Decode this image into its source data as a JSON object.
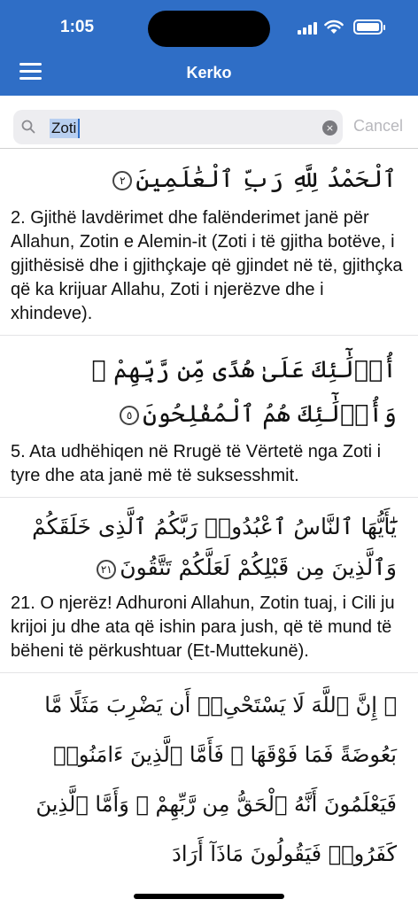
{
  "status_bar": {
    "time": "1:05"
  },
  "header": {
    "title": "Kerko"
  },
  "search": {
    "value": "Zoti",
    "cancel_label": "Cancel",
    "clear_icon": "×"
  },
  "verses": [
    {
      "arabic": "ٱلْحَمْدُ لِلَّهِ رَبِّ ٱلْعَٰلَمِينَ",
      "number_ar": "٢",
      "translation": "2. Gjithë lavdërimet dhe falënderimet janë për Allahun, Zotin e Alemin-it (Zoti i të gjitha botëve, i gjithësisë dhe i gjithçkaje që gjindet në të, gjithçka që ka krijuar Allahu, Zoti i njerëzve dhe i xhindeve)."
    },
    {
      "arabic": "أُو۟لَٰٓئِكَ عَلَىٰ هُدًى مِّن رَّبِّهِمْ ۖ وَأُو۟لَٰٓئِكَ هُمُ ٱلْمُفْلِحُونَ",
      "number_ar": "٥",
      "translation": "5. Ata udhëhiqen në Rrugë të Vërtetë nga Zoti i tyre dhe ata janë më të suksesshmit."
    },
    {
      "arabic": "يَٰٓأَيُّهَا ٱلنَّاسُ ٱعْبُدُوا۟ رَبَّكُمُ ٱلَّذِى خَلَقَكُمْ وَٱلَّذِينَ مِن قَبْلِكُمْ لَعَلَّكُمْ تَتَّقُونَ",
      "number_ar": "٢١",
      "translation": "21. O njerëz! Adhuroni Allahun, Zotin tuaj, i Cili ju krijoi ju dhe ata që ishin para jush, që të mund të bëheni të përkushtuar (Et-Muttekunë)."
    },
    {
      "arabic": "۞ إِنَّ ٱللَّهَ لَا يَسْتَحْىِۦٓ أَن يَضْرِبَ مَثَلًا مَّا بَعُوضَةً فَمَا فَوْقَهَا ۚ فَأَمَّا ٱلَّذِينَ ءَامَنُوا۟ فَيَعْلَمُونَ أَنَّهُ ٱلْحَقُّ مِن رَّبِّهِمْ ۖ وَأَمَّا ٱلَّذِينَ كَفَرُوا۟ فَيَقُولُونَ مَاذَآ أَرَادَ",
      "number_ar": "",
      "translation": ""
    }
  ]
}
